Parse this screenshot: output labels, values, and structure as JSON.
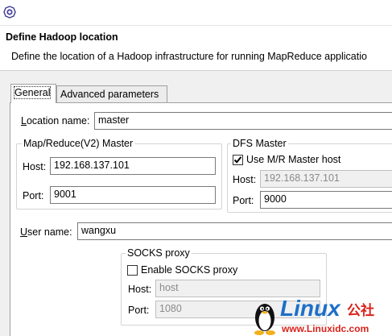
{
  "header": {
    "title": "Define Hadoop location",
    "description": "Define the location of a Hadoop infrastructure for running MapReduce applicatio"
  },
  "tabs": [
    {
      "label": "General",
      "active": true
    },
    {
      "label": "Advanced parameters",
      "active": false
    }
  ],
  "general": {
    "location_name_label": "Location name:",
    "location_name_value": "master",
    "mapreduce_group": {
      "title": "Map/Reduce(V2) Master",
      "host_label": "Host:",
      "host_value": "192.168.137.101",
      "port_label": "Port:",
      "port_value": "9001"
    },
    "dfs_group": {
      "title": "DFS Master",
      "use_mr_master_label": "Use M/R Master host",
      "use_mr_master_checked": true,
      "host_label": "Host:",
      "host_value": "192.168.137.101",
      "port_label": "Port:",
      "port_value": "9000"
    },
    "user_name_label": "User name:",
    "user_name_value": "wangxu",
    "socks_group": {
      "title": "SOCKS proxy",
      "enable_label": "Enable SOCKS proxy",
      "enable_checked": false,
      "host_label": "Host:",
      "host_value": "host",
      "port_label": "Port:",
      "port_value": "1080"
    }
  },
  "watermark": {
    "brand": "Linux",
    "brand_suffix": "公社",
    "url": "www.Linuxidc.com"
  },
  "colors": {
    "watermark_blue": "#1e6fc8",
    "watermark_red": "#d9231c",
    "border": "#7a7a7a"
  }
}
